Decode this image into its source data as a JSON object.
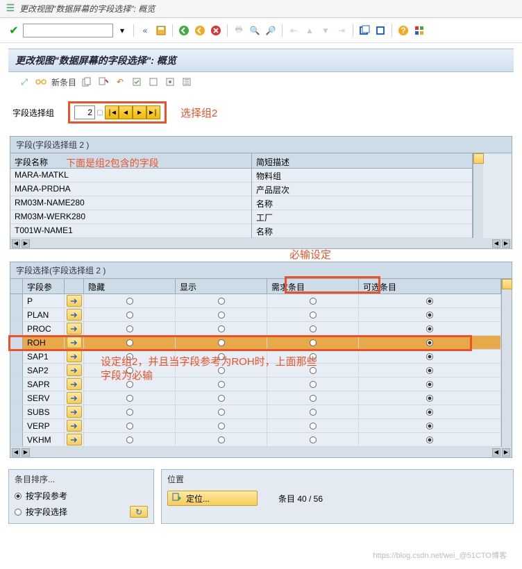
{
  "window_title": "更改视图\"数据屏幕的字段选择\": 概览",
  "page_title": "更改视图\"数据屏幕的字段选择\": 概览",
  "toolbar": {
    "new_entry": "新条目"
  },
  "group": {
    "label": "字段选择组",
    "value": "2",
    "annotation": "选择组2"
  },
  "fields_panel": {
    "header": "字段(字段选择组  2 )",
    "col_fieldname": "字段名称",
    "col_shortdesc": "简短描述",
    "annotation": "下面是组2包含的字段",
    "rows": [
      {
        "name": "MARA-MATKL",
        "desc": "物料组"
      },
      {
        "name": "MARA-PRDHA",
        "desc": "产品层次"
      },
      {
        "name": "RM03M-NAME280",
        "desc": "名称"
      },
      {
        "name": "RM03M-WERK280",
        "desc": "工厂"
      },
      {
        "name": "T001W-NAME1",
        "desc": "名称"
      }
    ]
  },
  "sel_panel": {
    "header": "字段选择(字段选择组  2 )",
    "annotation_top": "必输设定",
    "col_ref": "字段参考",
    "col_hidden": "隐藏",
    "col_display": "显示",
    "col_req": "需求条目",
    "col_opt": "可选条目",
    "annotation_body1": "设定组2，并且当字段参考为ROH时，上面那些",
    "annotation_body2": "字段为必输",
    "rows": [
      {
        "ref": "P",
        "sel": "opt"
      },
      {
        "ref": "PLAN",
        "sel": "opt"
      },
      {
        "ref": "PROC",
        "sel": "opt"
      },
      {
        "ref": "ROH",
        "sel": "opt",
        "highlight": true
      },
      {
        "ref": "SAP1",
        "sel": "opt"
      },
      {
        "ref": "SAP2",
        "sel": "opt"
      },
      {
        "ref": "SAPR",
        "sel": "opt"
      },
      {
        "ref": "SERV",
        "sel": "opt"
      },
      {
        "ref": "SUBS",
        "sel": "opt"
      },
      {
        "ref": "VERP",
        "sel": "opt"
      },
      {
        "ref": "VKHM",
        "sel": "opt"
      }
    ]
  },
  "sort": {
    "header": "条目排序...",
    "by_ref": "按字段参考",
    "by_sel": "按字段选择"
  },
  "loc": {
    "header": "位置",
    "button": "定位...",
    "count": "条目 40 / 56"
  },
  "watermark": "https://blog.csdn.net/wei_@51CTO博客"
}
